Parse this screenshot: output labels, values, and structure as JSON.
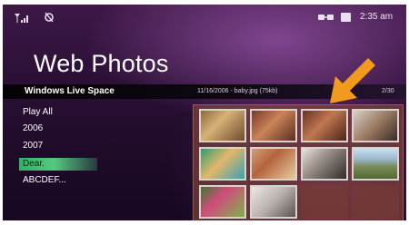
{
  "status": {
    "time": "2:35 am"
  },
  "title": "Web Photos",
  "header_bar": {
    "source": "Windows Live Space",
    "info": "11/16/2006 - baby.jpg (75kb)",
    "counter": "2/30"
  },
  "menu": [
    {
      "label": "Play All"
    },
    {
      "label": "2006"
    },
    {
      "label": "2007"
    },
    {
      "label": "Dear."
    },
    {
      "label": "ABCDEF..."
    }
  ],
  "selected_menu_label": "Dear.",
  "colors": {
    "accent_selected": "#55c97c",
    "arrow": "#f29a1e"
  },
  "thumbnails": [
    {
      "name": "photo-thumb-1"
    },
    {
      "name": "photo-thumb-2"
    },
    {
      "name": "photo-thumb-3"
    },
    {
      "name": "photo-thumb-4"
    },
    {
      "name": "photo-thumb-5"
    },
    {
      "name": "photo-thumb-6"
    },
    {
      "name": "photo-thumb-7"
    },
    {
      "name": "photo-thumb-8"
    },
    {
      "name": "photo-thumb-9"
    },
    {
      "name": "photo-thumb-10"
    },
    {
      "name": "empty-slot"
    },
    {
      "name": "empty-slot"
    }
  ]
}
